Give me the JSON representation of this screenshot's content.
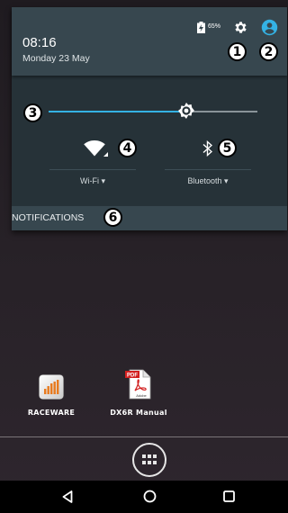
{
  "status": {
    "time": "08:16",
    "date": "Monday 23 May",
    "battery": "65%"
  },
  "quick_settings": {
    "brightness_level": 0.66,
    "wifi_label": "Wi-Fi",
    "bluetooth_label": "Bluetooth",
    "accent_color": "#34b2e4",
    "header_color": "#37474f",
    "panel_color": "#263238"
  },
  "notifications": {
    "label": "NOTIFICATIONS"
  },
  "callouts": [
    "1",
    "2",
    "3",
    "4",
    "5",
    "6"
  ],
  "home": {
    "apps": [
      {
        "label": "RACEWARE",
        "icon": "raceware-app-icon"
      },
      {
        "label": "DX6R Manual",
        "icon": "pdf-document-icon"
      }
    ],
    "pdf_badge": "PDF",
    "pdf_brand": "Adobe"
  },
  "navigation": {
    "buttons": [
      "back-icon",
      "home-icon",
      "recents-icon"
    ]
  }
}
